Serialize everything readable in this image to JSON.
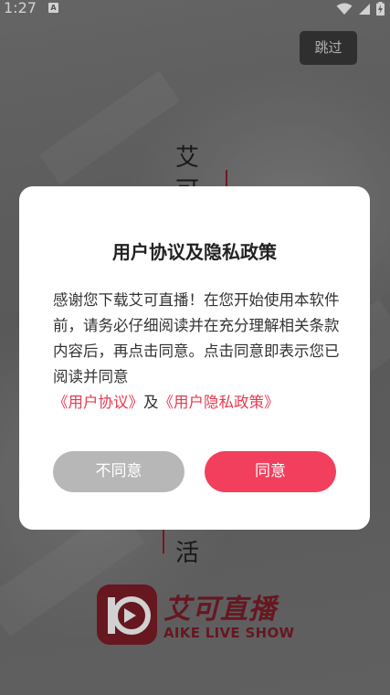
{
  "status_bar": {
    "time": "1:27",
    "notification_badge": "A",
    "icons": [
      "wifi-icon",
      "cellular-icon",
      "battery-charging-icon"
    ]
  },
  "skip_label": "跳过",
  "slogan": {
    "top_chars": [
      "艾",
      "可"
    ],
    "bottom_char": "活"
  },
  "brand": {
    "name": "艾可直播",
    "subtitle": "AIKE LIVE SHOW",
    "logo_letter": "D"
  },
  "dialog": {
    "title": "用户协议及隐私政策",
    "body_text": "感谢您下载艾可直播！在您开始使用本软件前，请务必仔细阅读并在充分理解相关条款内容后，再点击同意。点击同意即表示您已阅读并同意",
    "link_user_agreement": "《用户协议》",
    "connector": "及",
    "link_privacy_policy": "《用户隐私政策》",
    "disagree_label": "不同意",
    "agree_label": "同意"
  },
  "colors": {
    "accent": "#f23f5e",
    "link": "#e8394f",
    "brand": "#7d1d28",
    "disagree_button": "#b7b7b7"
  }
}
